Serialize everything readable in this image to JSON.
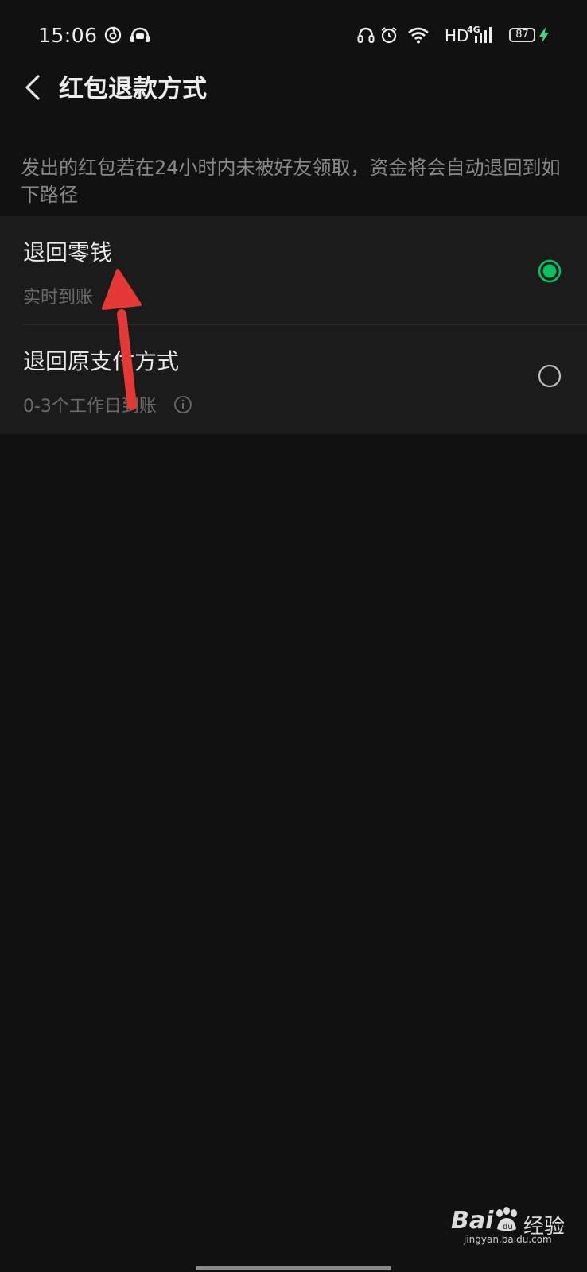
{
  "status_bar": {
    "time": "15:06",
    "network_label": "HD",
    "signal_label": "4G",
    "battery_level": "87",
    "notification_icons": [
      "netease-music-icon",
      "headset-avatar-icon"
    ],
    "system_icons": [
      "headphone-icon",
      "alarm-icon",
      "wifi-icon",
      "signal-icon",
      "battery-icon",
      "charging-icon"
    ],
    "charging_color": "#3ddc84"
  },
  "nav": {
    "title": "红包退款方式"
  },
  "notice": "发出的红包若在24小时内未被好友领取，资金将会自动退回到如下路径",
  "options": [
    {
      "title": "退回零钱",
      "subtitle": "实时到账",
      "selected": true
    },
    {
      "title": "退回原支付方式",
      "subtitle": "0-3个工作日到账",
      "selected": false
    }
  ],
  "accent_color": "#07c160",
  "annotation_color": "#e53935",
  "watermark": {
    "text": "Bai",
    "text2": "经验",
    "url": "jingyan.baidu.com"
  }
}
